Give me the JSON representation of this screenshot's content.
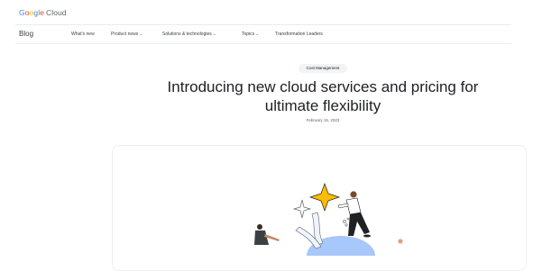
{
  "header": {
    "logo_text": "Google Cloud",
    "logo_letters": [
      "G",
      "o",
      "o",
      "g",
      "l",
      "e"
    ],
    "logo_cloud": "Cloud",
    "logo_colors": [
      "#4285f4",
      "#ea4335",
      "#fbbc04",
      "#4285f4",
      "#34a853",
      "#ea4335"
    ]
  },
  "nav": {
    "blog_label": "Blog",
    "items": [
      {
        "label": "What's new",
        "has_dropdown": false
      },
      {
        "label": "Product news",
        "has_dropdown": true
      },
      {
        "label": "Solutions & technologies",
        "has_dropdown": true
      },
      {
        "label": "Topics",
        "has_dropdown": true
      },
      {
        "label": "Transformation Leaders",
        "has_dropdown": false
      }
    ],
    "dropdown_icon": "chevron-down-icon"
  },
  "article": {
    "category_tag": "Cost Management",
    "title": "Introducing new cloud services and pricing for ultimate flexibility",
    "date": "February 15, 2023"
  },
  "hero": {
    "illustration": "people-with-star-and-globe-illustration",
    "star_color": "#fbbc04",
    "globe_color": "#a8c7fa"
  }
}
